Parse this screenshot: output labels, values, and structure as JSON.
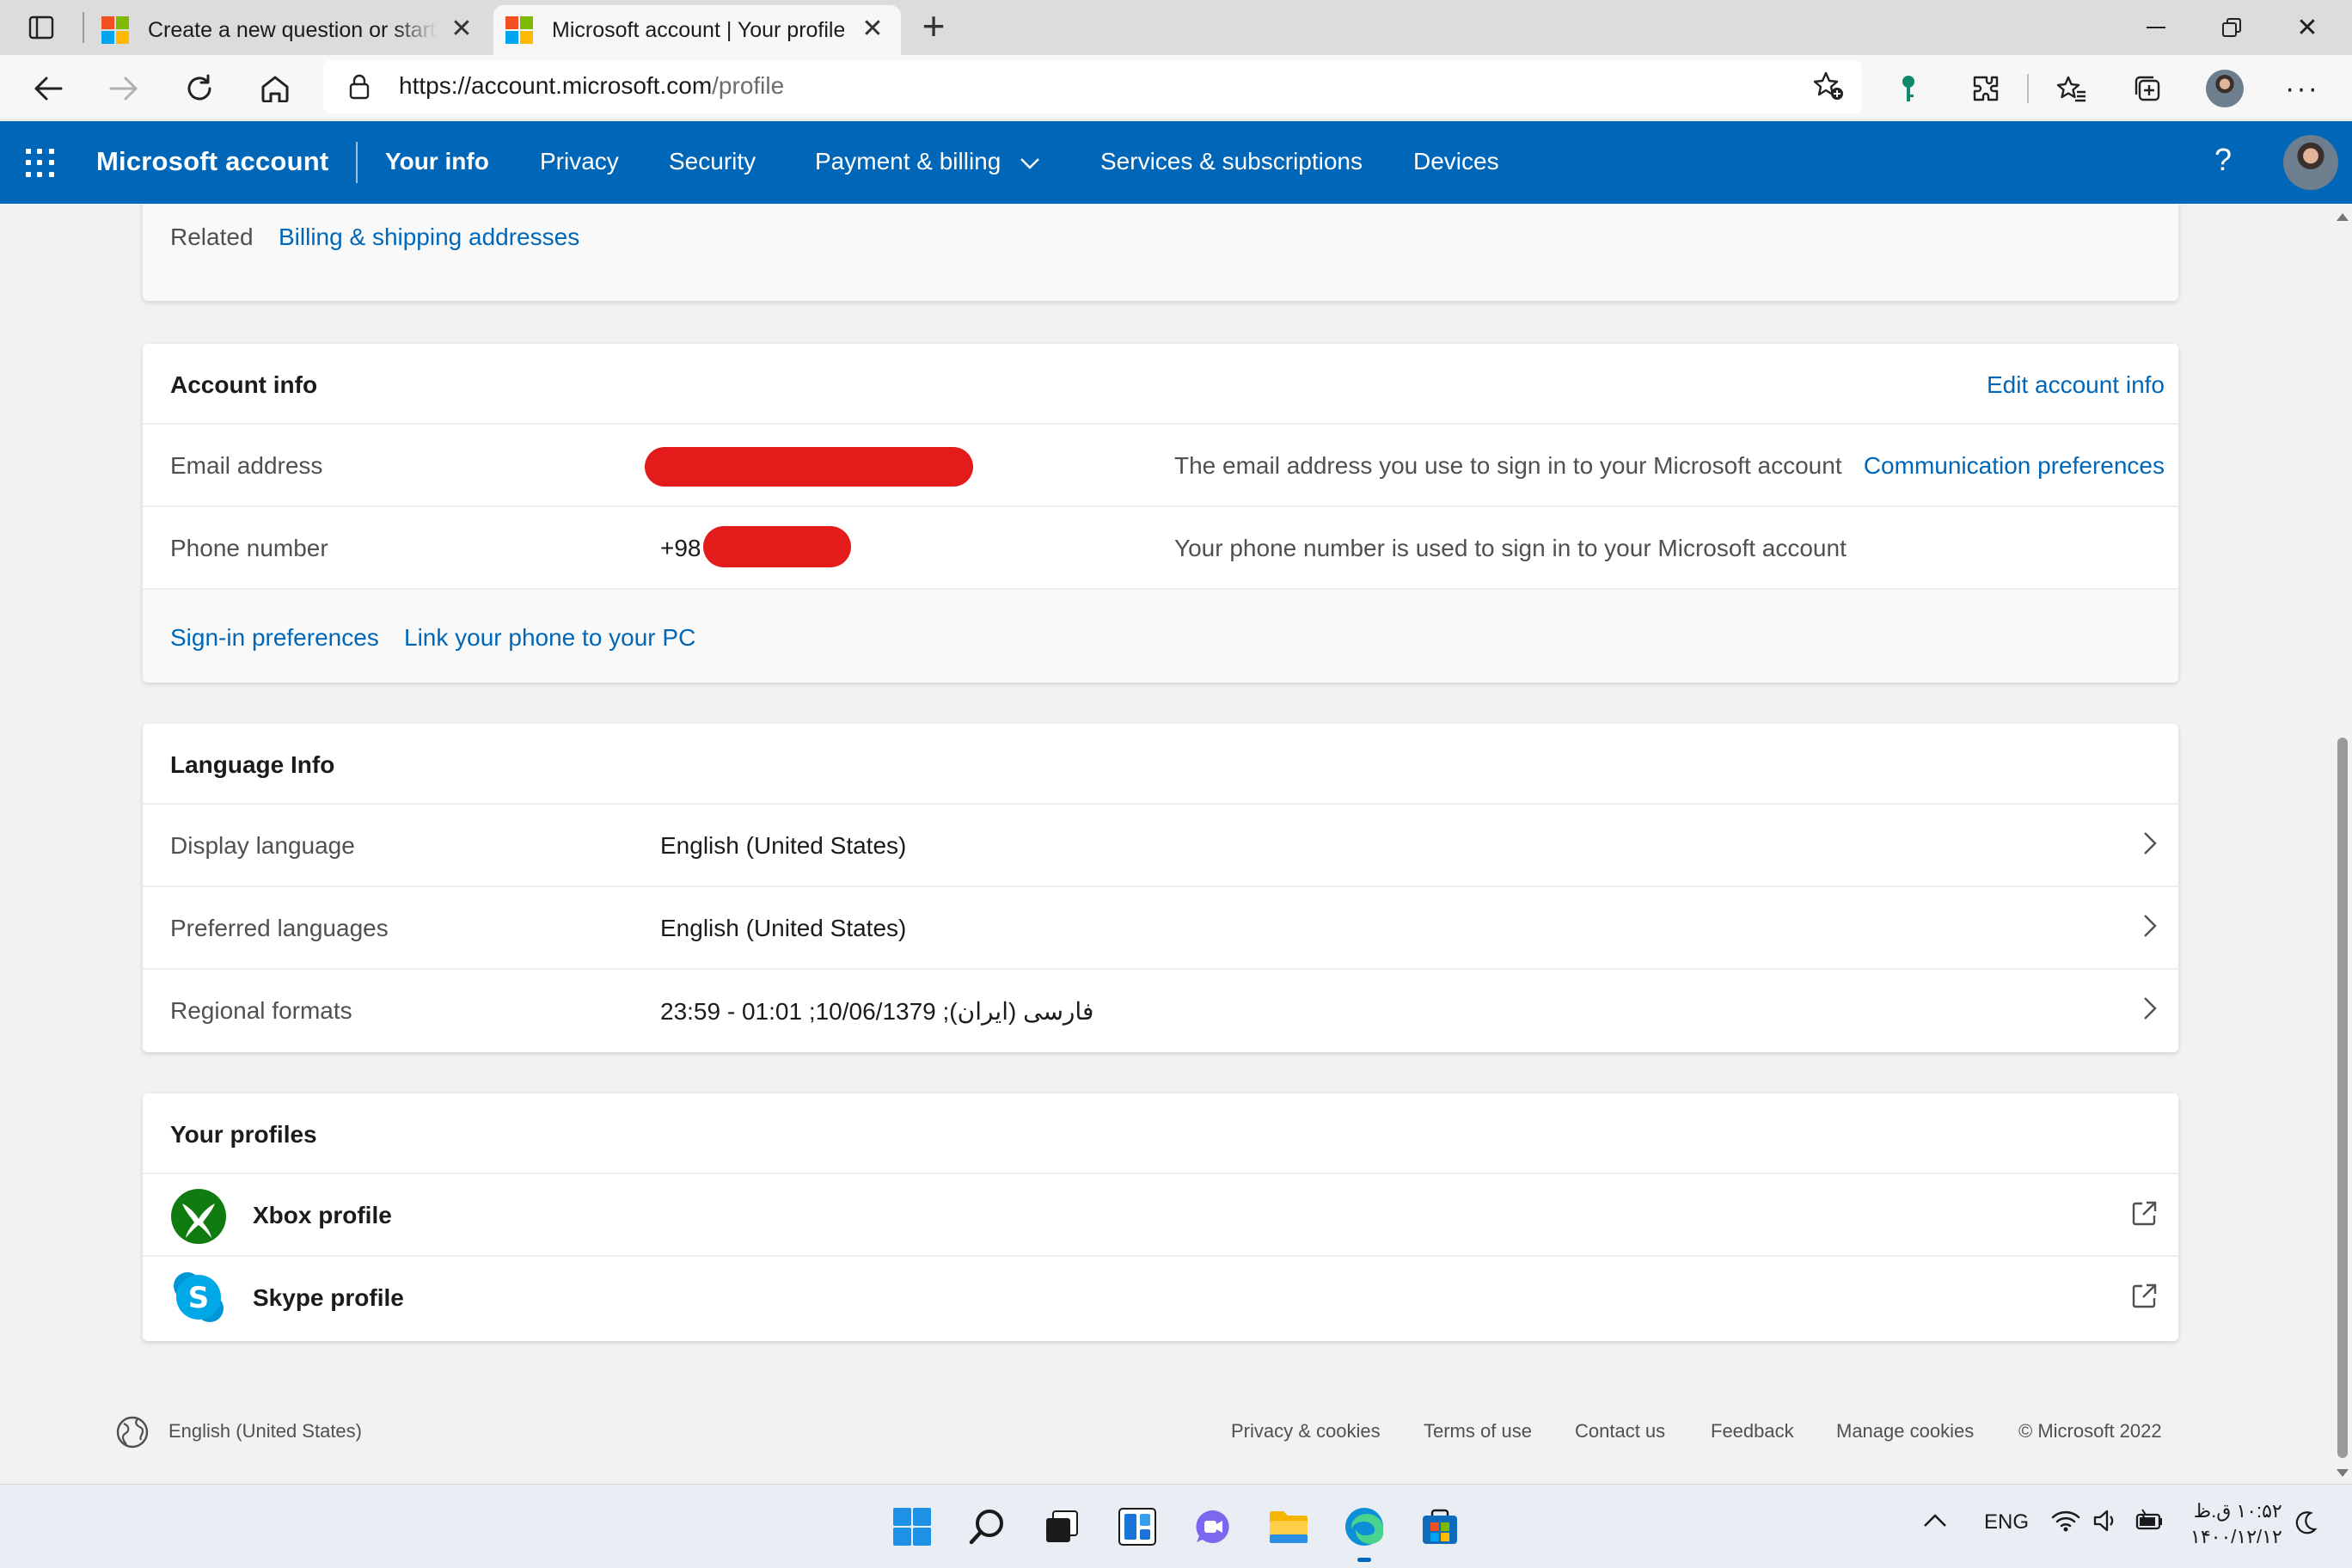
{
  "browser": {
    "tabs": [
      {
        "title": "Create a new question or start a",
        "active": false
      },
      {
        "title": "Microsoft account | Your profile",
        "active": true
      }
    ],
    "url_host": "https://account.microsoft.com",
    "url_path": "/profile"
  },
  "msnav": {
    "brand": "Microsoft account",
    "items": [
      {
        "label": "Your info",
        "active": true
      },
      {
        "label": "Privacy"
      },
      {
        "label": "Security"
      },
      {
        "label": "Payment & billing"
      },
      {
        "label": "Services & subscriptions"
      },
      {
        "label": "Devices"
      }
    ],
    "help": "?"
  },
  "related": {
    "label": "Related",
    "link": "Billing & shipping addresses"
  },
  "account_info": {
    "title": "Account info",
    "edit": "Edit account info",
    "email_label": "Email address",
    "email_desc": "The email address you use to sign in to your Microsoft account",
    "email_link": "Communication preferences",
    "phone_label": "Phone number",
    "phone_prefix": "+98",
    "phone_desc": "Your phone number is used to sign in to your Microsoft account",
    "signin_pref": "Sign-in preferences",
    "link_phone": "Link your phone to your PC"
  },
  "language_info": {
    "title": "Language Info",
    "rows": [
      {
        "label": "Display language",
        "value": "English (United States)"
      },
      {
        "label": "Preferred languages",
        "value": "English (United States)"
      },
      {
        "label": "Regional formats",
        "value": "فارسی (ایران); 10/06/1379; 01:01 - 23:59"
      }
    ]
  },
  "profiles": {
    "title": "Your profiles",
    "xbox": "Xbox profile",
    "skype": "Skype profile"
  },
  "footer": {
    "language": "English (United States)",
    "links": [
      "Privacy & cookies",
      "Terms of use",
      "Contact us",
      "Feedback",
      "Manage cookies"
    ],
    "copyright": "© Microsoft 2022"
  },
  "taskbar": {
    "lang": "ENG",
    "time": "۱۰:۵۲ ق.ظ",
    "date": "۱۴۰۰/۱۲/۱۲"
  },
  "colors": {
    "accent": "#0067b8",
    "redaction": "#e31b1b"
  }
}
